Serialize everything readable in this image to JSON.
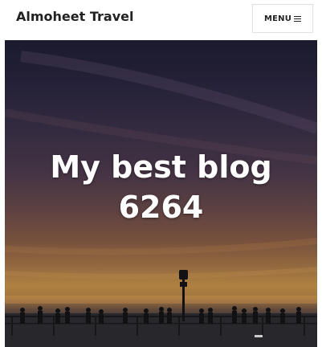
{
  "header": {
    "site_title": "Almoheet Travel",
    "menu_label": "MENU"
  },
  "hero": {
    "title_line1": "My best blog",
    "title_line2": "6264",
    "image_icon": "pier-sunset-image"
  },
  "colors": {
    "text_dark": "#222222",
    "hero_text": "#ffffff",
    "menu_border": "#e1e1e1"
  }
}
